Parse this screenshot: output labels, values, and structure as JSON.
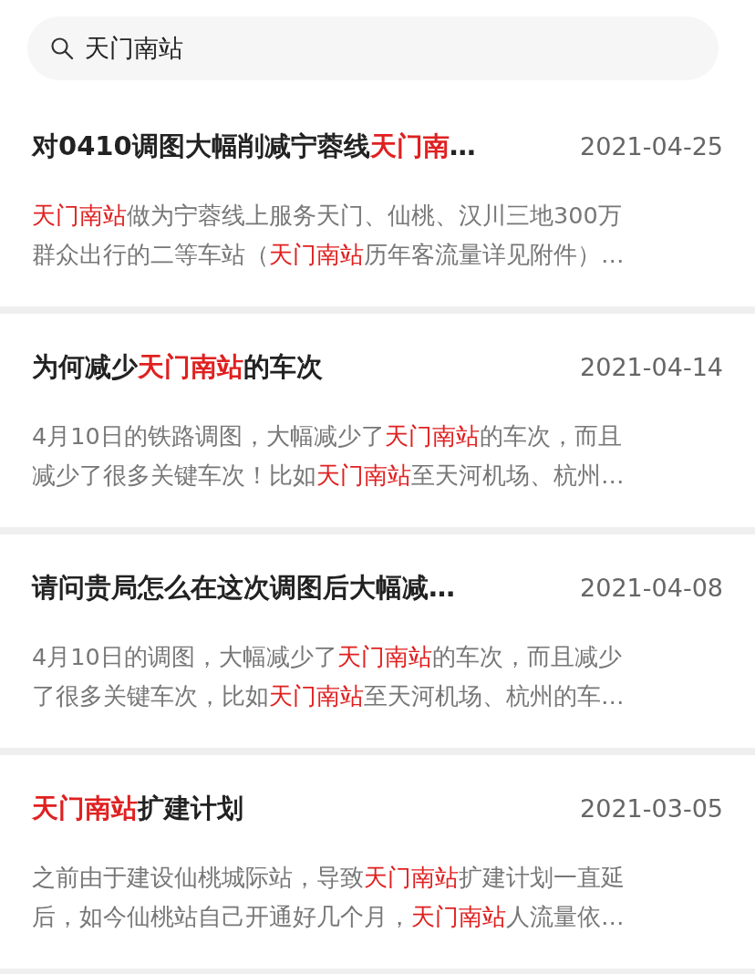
{
  "search": {
    "value": "天门南站"
  },
  "results": [
    {
      "title": [
        {
          "text": "对0410调图大幅削减宁蓉线",
          "highlight": false
        },
        {
          "text": "天门南",
          "highlight": true
        },
        {
          "text": "…",
          "highlight": false
        }
      ],
      "date": "2021-04-25",
      "snippet": [
        [
          {
            "text": "天门南站",
            "highlight": true
          },
          {
            "text": "做为宁蓉线上服务天门、仙桃、汉川三地300万",
            "highlight": false
          }
        ],
        [
          {
            "text": "群众出行的二等车站（",
            "highlight": false
          },
          {
            "text": "天门南站",
            "highlight": true
          },
          {
            "text": "历年客流量详见附件）…",
            "highlight": false
          }
        ]
      ]
    },
    {
      "title": [
        {
          "text": "为何减少",
          "highlight": false
        },
        {
          "text": "天门南站",
          "highlight": true
        },
        {
          "text": "的车次",
          "highlight": false
        }
      ],
      "date": "2021-04-14",
      "snippet": [
        [
          {
            "text": "4月10日的铁路调图，大幅减少了",
            "highlight": false
          },
          {
            "text": "天门南站",
            "highlight": true
          },
          {
            "text": "的车次，而且",
            "highlight": false
          }
        ],
        [
          {
            "text": "减少了很多关键车次！比如",
            "highlight": false
          },
          {
            "text": "天门南站",
            "highlight": true
          },
          {
            "text": "至天河机场、杭州…",
            "highlight": false
          }
        ]
      ]
    },
    {
      "title": [
        {
          "text": "请问贵局怎么在这次调图后大幅减…",
          "highlight": false
        }
      ],
      "date": "2021-04-08",
      "snippet": [
        [
          {
            "text": "4月10日的调图，大幅减少了",
            "highlight": false
          },
          {
            "text": "天门南站",
            "highlight": true
          },
          {
            "text": "的车次，而且减少",
            "highlight": false
          }
        ],
        [
          {
            "text": "了很多关键车次，比如",
            "highlight": false
          },
          {
            "text": "天门南站",
            "highlight": true
          },
          {
            "text": "至天河机场、杭州的车…",
            "highlight": false
          }
        ]
      ]
    },
    {
      "title": [
        {
          "text": "天门南站",
          "highlight": true
        },
        {
          "text": "扩建计划",
          "highlight": false
        }
      ],
      "date": "2021-03-05",
      "snippet": [
        [
          {
            "text": "之前由于建设仙桃城际站，导致",
            "highlight": false
          },
          {
            "text": "天门南站",
            "highlight": true
          },
          {
            "text": "扩建计划一直延",
            "highlight": false
          }
        ],
        [
          {
            "text": "后，如今仙桃站自己开通好几个月，",
            "highlight": false
          },
          {
            "text": "天门南站",
            "highlight": true
          },
          {
            "text": "人流量依…",
            "highlight": false
          }
        ]
      ]
    }
  ]
}
